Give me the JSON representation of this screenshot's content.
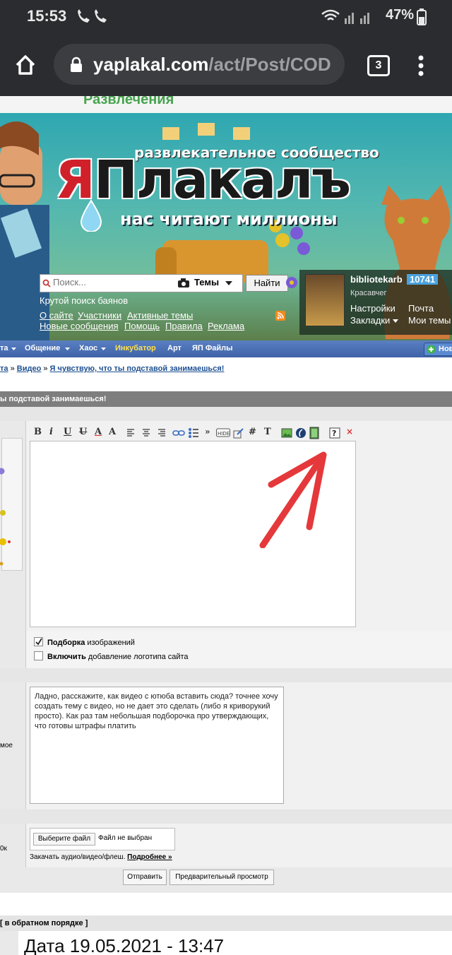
{
  "status_bar": {
    "time": "15:53",
    "battery": "47%"
  },
  "browser": {
    "url_host": "yaplakal.com",
    "url_path": "/act/Post/COD",
    "tab_count": "3"
  },
  "site": {
    "category": "Развлечения",
    "logo": {
      "ya": "Я",
      "rest": "Плакалъ"
    },
    "slogan_top": "развлекательное сообщество",
    "slogan_bottom": "нас читают миллионы",
    "search": {
      "placeholder": "Поиск...",
      "scope": "Темы",
      "button": "Найти",
      "hint": "Крутой поиск баянов"
    },
    "links_row1": [
      "О сайте",
      "Участники",
      "Активные темы"
    ],
    "links_row2": [
      "Новые сообщения",
      "Помощь",
      "Правила",
      "Реклама"
    ],
    "user": {
      "name": "bibliotekarb",
      "rating": "10741",
      "rank": "Красавчег",
      "settings": "Настройки",
      "mail": "Почта",
      "bookmarks": "Закладки",
      "my_topics": "Мои темы"
    }
  },
  "menu": {
    "items": [
      "та",
      "Общение",
      "Хаос",
      "Инкубатор",
      "Арт",
      "ЯП Файлы"
    ],
    "new_button": "Нов"
  },
  "breadcrumb": {
    "part1": "та",
    "sep": "»",
    "video": "Видео",
    "topic": "Я чувствую, что ты подставой занимаешься!"
  },
  "topic_title": "ы подставой занимаешься!",
  "options": {
    "images_bold": "Подборка",
    "images_rest": " изображений",
    "logo_bold": "Включить",
    "logo_rest": " добавление логотипа сайта"
  },
  "left_labels": {
    "description": "мое",
    "file_size": "0к"
  },
  "description_text": "Ладно, расскажите, как видео с ютюба вставить сюда? точнее хочу создать тему с видео, но не дает это сделать (либо я криворукий просто). Как раз там небольшая подборочка про утверждающих, что готовы штрафы платить",
  "upload": {
    "choose": "Выберите файл",
    "none": "Файл не выбран",
    "hint": "Закачать аудио/видео/флеш.",
    "more": "Подробнее »"
  },
  "buttons": {
    "submit": "Отправить",
    "preview": "Предварительный просмотр"
  },
  "reverse_order": "[ в обратном порядке ]",
  "date_line": "Дата 19.05.2021 - 13:47",
  "colors": {
    "annotation_arrow": "#e5383b",
    "menu_bg": "#4a6fb5",
    "link": "#1d4f91"
  }
}
